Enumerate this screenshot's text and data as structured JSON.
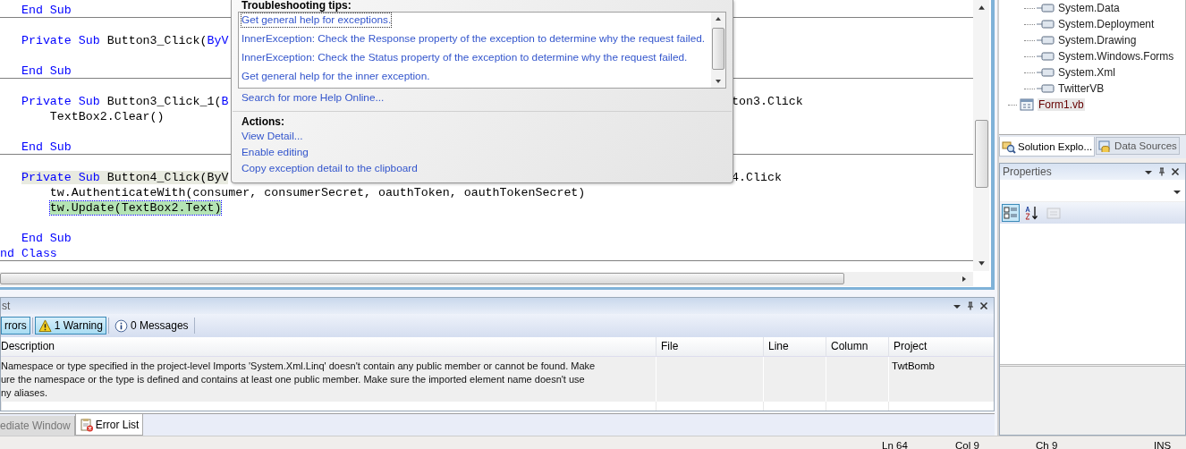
{
  "editor": {
    "lines": [
      {
        "kind": "code",
        "statement_highlight": false,
        "call_highlight": false,
        "divider_below": true,
        "tokens": [
          {
            "kind": "keyword",
            "text": "   End Sub"
          }
        ]
      },
      {
        "kind": "blank",
        "divider_below": false
      },
      {
        "kind": "code",
        "statement_highlight": false,
        "call_highlight": false,
        "divider_below": false,
        "tokens": [
          {
            "kind": "keyword",
            "text": "   Private Sub"
          },
          {
            "kind": "plain",
            "text": " Button3_Click("
          },
          {
            "kind": "keyword",
            "text": "ByV"
          }
        ]
      },
      {
        "kind": "blank",
        "divider_below": false
      },
      {
        "kind": "code",
        "statement_highlight": false,
        "call_highlight": false,
        "divider_below": true,
        "tokens": [
          {
            "kind": "keyword",
            "text": "   End Sub"
          }
        ]
      },
      {
        "kind": "blank",
        "divider_below": false
      },
      {
        "kind": "code",
        "statement_highlight": false,
        "call_highlight": false,
        "divider_below": false,
        "tokens": [
          {
            "kind": "keyword",
            "text": "   Private Sub"
          },
          {
            "kind": "plain",
            "text": " Button3_Click_1("
          },
          {
            "kind": "keyword",
            "text": "B"
          }
        ],
        "tail": "ton3.Click"
      },
      {
        "kind": "code",
        "statement_highlight": false,
        "call_highlight": false,
        "divider_below": false,
        "tokens": [
          {
            "kind": "plain",
            "text": "       TextBox2.Clear()"
          }
        ]
      },
      {
        "kind": "blank",
        "divider_below": false
      },
      {
        "kind": "code",
        "statement_highlight": false,
        "call_highlight": false,
        "divider_below": true,
        "tokens": [
          {
            "kind": "keyword",
            "text": "   End Sub"
          }
        ]
      },
      {
        "kind": "blank",
        "divider_below": false
      },
      {
        "kind": "code",
        "statement_highlight": false,
        "call_highlight": true,
        "divider_below": false,
        "tokens": [
          {
            "kind": "keyword",
            "text": "   Private Sub"
          },
          {
            "kind": "plain",
            "text": " Button4_Click(ByV"
          }
        ],
        "tail": "4.Click"
      },
      {
        "kind": "code",
        "statement_highlight": false,
        "call_highlight": false,
        "divider_below": false,
        "tokens": [
          {
            "kind": "plain",
            "text": "       tw.AuthenticateWith(consumer, consumerSecret, oauthToken, oauthTokenSecret)"
          }
        ]
      },
      {
        "kind": "code",
        "statement_highlight": true,
        "call_highlight": false,
        "divider_below": false,
        "tokens": [
          {
            "kind": "plain",
            "text": "       tw.Update(TextBox2.Text)"
          }
        ]
      },
      {
        "kind": "blank",
        "divider_below": false
      },
      {
        "kind": "code",
        "statement_highlight": false,
        "call_highlight": false,
        "divider_below": false,
        "tokens": [
          {
            "kind": "keyword",
            "text": "   End Sub"
          }
        ]
      },
      {
        "kind": "code",
        "statement_highlight": false,
        "call_highlight": false,
        "divider_below": true,
        "tokens": [
          {
            "kind": "keyword",
            "text": "nd Class"
          }
        ]
      }
    ]
  },
  "exception_popup": {
    "tips_title": "Troubleshooting tips:",
    "tips": [
      {
        "text": "Get general help for exceptions.",
        "focused": true
      },
      {
        "text": "InnerException: Check the Response property of the exception to determine why the request failed.",
        "focused": false
      },
      {
        "text": "InnerException: Check the Status property of the exception to determine why the request failed.",
        "focused": false
      },
      {
        "text": "Get general help for the inner exception.",
        "focused": false
      }
    ],
    "help_link": "Search for more Help Online...",
    "actions_title": "Actions:",
    "actions": [
      "View Detail...",
      "Enable editing",
      "Copy exception detail to the clipboard"
    ]
  },
  "solution_tree": {
    "items": [
      {
        "kind": "group",
        "children": [
          {
            "kind": "reference",
            "label": "System.Data",
            "selected": false
          },
          {
            "kind": "reference",
            "label": "System.Deployment",
            "selected": false
          },
          {
            "kind": "reference",
            "label": "System.Drawing",
            "selected": false
          },
          {
            "kind": "reference",
            "label": "System.Windows.Forms",
            "selected": false
          },
          {
            "kind": "reference",
            "label": "System.Xml",
            "selected": false
          },
          {
            "kind": "reference",
            "label": "TwitterVB",
            "selected": false
          }
        ]
      },
      {
        "kind": "form",
        "label": "Form1.vb",
        "selected": true
      }
    ]
  },
  "side_tabs": [
    {
      "kind": "solution",
      "label": "Solution Explo...",
      "selected": true
    },
    {
      "kind": "data",
      "label": "Data Sources",
      "selected": false
    }
  ],
  "properties": {
    "title": "Properties",
    "view_buttons": [
      {
        "kind": "categorized",
        "selected": true,
        "disabled": false
      },
      {
        "kind": "alphabetical",
        "selected": false,
        "disabled": false
      },
      {
        "kind": "pages",
        "selected": false,
        "disabled": true
      }
    ]
  },
  "error_list": {
    "title": "st",
    "filters": [
      {
        "kind": "error",
        "label": "rrors",
        "selected": true
      },
      {
        "kind": "warning",
        "label": "1 Warning",
        "selected": true
      },
      {
        "kind": "message",
        "label": "0 Messages",
        "selected": false
      }
    ],
    "columns": [
      "Description",
      "File",
      "Line",
      "Column",
      "Project"
    ],
    "rows": [
      {
        "description_lines": [
          "Namespace or type specified in the project-level Imports 'System.Xml.Linq' doesn't contain any public member or cannot be found. Make",
          "ure the namespace or the type is defined and contains at least one public member. Make sure the imported element name doesn't use",
          "ny aliases."
        ],
        "project": "TwtBomb"
      }
    ]
  },
  "bottom_tabs": [
    {
      "kind": "immediate",
      "label": "ediate Window",
      "selected": false
    },
    {
      "kind": "errors",
      "label": "Error List",
      "selected": true
    }
  ],
  "status_bar": [
    "Ln 64",
    "Col 9",
    "Ch 9",
    "INS"
  ]
}
